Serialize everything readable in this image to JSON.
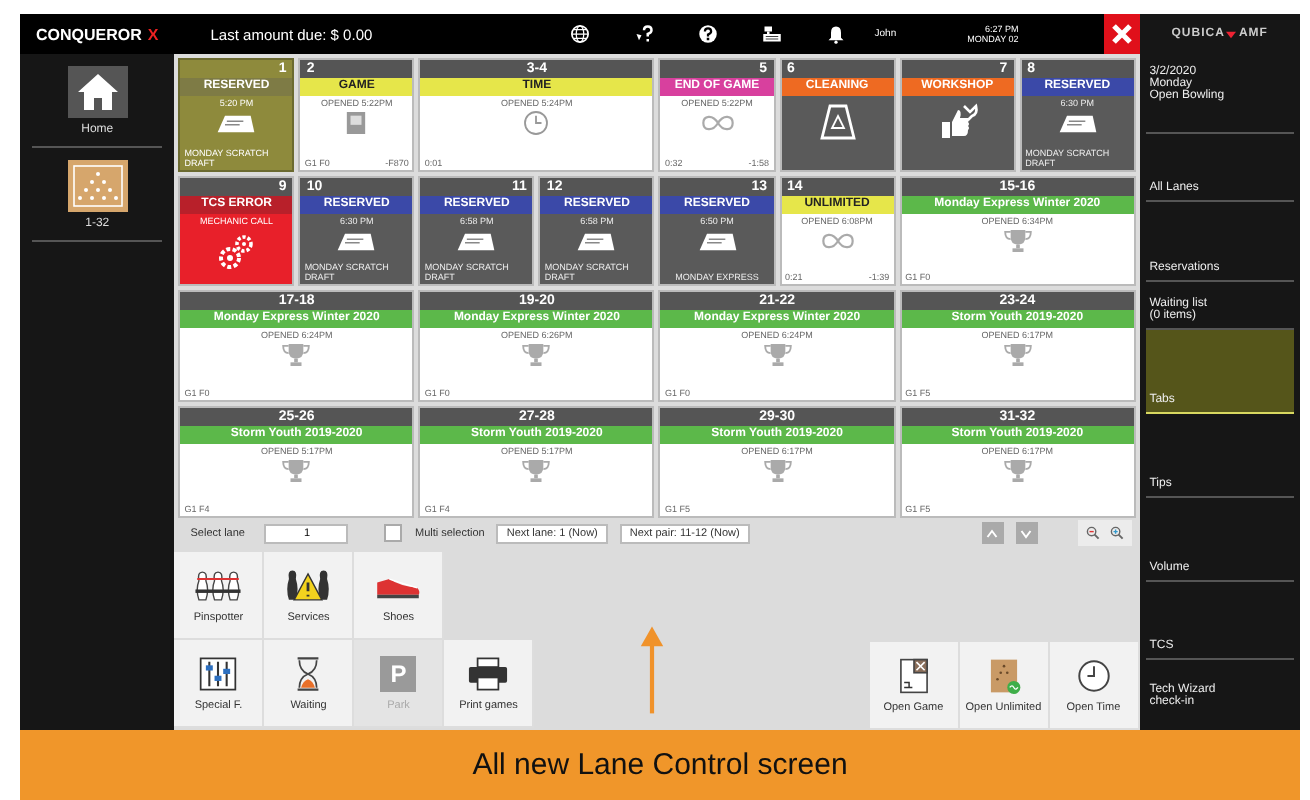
{
  "app_logo": {
    "name": "CONQUEROR",
    "mark": "X"
  },
  "top_bar": {
    "amount_due": "Last amount due: $ 0.00",
    "user": "John",
    "time": "6:27 PM",
    "date": "MONDAY 02"
  },
  "vendor_logo": {
    "left": "QUBICA",
    "right": "AMF"
  },
  "left_nav": [
    {
      "label": "Home"
    },
    {
      "label": "1-32"
    }
  ],
  "lanes": [
    {
      "number": "1",
      "kind": "reserved",
      "selected": true,
      "status": "RESERVED",
      "color": "#7e7b45",
      "info": "5:20 PM",
      "footer_left": "MONDAY SCRATCH DRAFT"
    },
    {
      "number": "2",
      "kind": "game",
      "selected": false,
      "status": "GAME",
      "color": "#e6e64a",
      "info": "OPENED 5:22PM",
      "footer_left": "G1 F0",
      "footer_right": "-F870"
    },
    {
      "number": "3-4",
      "kind": "time",
      "selected": false,
      "status": "TIME",
      "color": "#e6e64a",
      "info": "OPENED 5:24PM",
      "footer_left": "0:01"
    },
    {
      "number": "5",
      "kind": "end",
      "selected": false,
      "status": "END OF GAME",
      "color": "#d8409e",
      "info": "OPENED 5:22PM",
      "footer_left": "0:32",
      "footer_right": "-1:58"
    },
    {
      "number": "6",
      "kind": "cleaning",
      "selected": false,
      "status": "CLEANING",
      "color": "#ee6a22"
    },
    {
      "number": "7",
      "kind": "workshop",
      "selected": false,
      "status": "WORKSHOP",
      "color": "#ee6a22"
    },
    {
      "number": "8",
      "kind": "reserved",
      "selected": false,
      "status": "RESERVED",
      "color": "#3b49a8",
      "info": "6:30 PM",
      "footer_left": "MONDAY SCRATCH DRAFT"
    },
    {
      "number": "9",
      "kind": "error",
      "selected": false,
      "status": "TCS ERROR",
      "color": "#b8202a",
      "info": "MECHANIC CALL"
    },
    {
      "number": "10",
      "kind": "reserved",
      "selected": false,
      "status": "RESERVED",
      "color": "#3b49a8",
      "info": "6:30 PM",
      "footer_left": "MONDAY SCRATCH DRAFT"
    },
    {
      "number": "11",
      "kind": "reserved",
      "selected": false,
      "status": "RESERVED",
      "color": "#3b49a8",
      "info": "6:58 PM",
      "footer_left": "MONDAY SCRATCH DRAFT"
    },
    {
      "number": "12",
      "kind": "reserved",
      "selected": false,
      "status": "RESERVED",
      "color": "#3b49a8",
      "info": "6:58 PM",
      "footer_left": "MONDAY SCRATCH DRAFT"
    },
    {
      "number": "13",
      "kind": "reserved",
      "selected": false,
      "status": "RESERVED",
      "color": "#3b49a8",
      "info": "6:50 PM",
      "footer_left": "MONDAY EXPRESS"
    },
    {
      "number": "14",
      "kind": "unlimited",
      "selected": false,
      "status": "UNLIMITED",
      "color": "#e6e64a",
      "info": "OPENED 6:08PM",
      "footer_left": "0:21",
      "footer_right": "-1:39"
    },
    {
      "number": "15-16",
      "kind": "league",
      "selected": false,
      "status": "Monday Express Winter 2020",
      "color": "#5cb84a",
      "info": "OPENED 6:34PM",
      "footer_left": "G1 F0"
    },
    {
      "number": "17-18",
      "kind": "league",
      "selected": false,
      "status": "Monday Express Winter 2020",
      "color": "#5cb84a",
      "info": "OPENED 6:24PM",
      "footer_left": "G1 F0"
    },
    {
      "number": "19-20",
      "kind": "league",
      "selected": false,
      "status": "Monday Express Winter 2020",
      "color": "#5cb84a",
      "info": "OPENED 6:26PM",
      "footer_left": "G1 F0"
    },
    {
      "number": "21-22",
      "kind": "league",
      "selected": false,
      "status": "Monday Express Winter 2020",
      "color": "#5cb84a",
      "info": "OPENED 6:24PM",
      "footer_left": "G1 F0"
    },
    {
      "number": "23-24",
      "kind": "league",
      "selected": false,
      "status": "Storm Youth 2019-2020",
      "color": "#5cb84a",
      "info": "OPENED 6:17PM",
      "footer_left": "G1 F5"
    },
    {
      "number": "25-26",
      "kind": "league",
      "selected": false,
      "status": "Storm Youth 2019-2020",
      "color": "#5cb84a",
      "info": "OPENED 5:17PM",
      "footer_left": "G1 F4"
    },
    {
      "number": "27-28",
      "kind": "league",
      "selected": false,
      "status": "Storm Youth 2019-2020",
      "color": "#5cb84a",
      "info": "OPENED 5:17PM",
      "footer_left": "G1 F4"
    },
    {
      "number": "29-30",
      "kind": "league",
      "selected": false,
      "status": "Storm Youth 2019-2020",
      "color": "#5cb84a",
      "info": "OPENED 6:17PM",
      "footer_left": "G1 F5"
    },
    {
      "number": "31-32",
      "kind": "league",
      "selected": false,
      "status": "Storm Youth 2019-2020",
      "color": "#5cb84a",
      "info": "OPENED 6:17PM",
      "footer_left": "G1 F5"
    }
  ],
  "lane_toolbar": {
    "select_label": "Select lane",
    "select_value": "1",
    "multi_label": "Multi selection",
    "multi_checked": false,
    "next_lane": "Next lane: 1 (Now)",
    "next_pair": "Next pair: 11-12 (Now)"
  },
  "function_rows": [
    [
      {
        "label": "Pinspotter",
        "kind": "pins",
        "disabled": false
      },
      {
        "label": "Services",
        "kind": "warning",
        "disabled": false
      },
      {
        "label": "Shoes",
        "kind": "shoe",
        "disabled": false
      }
    ],
    [
      {
        "label": "Special F.",
        "kind": "sliders",
        "disabled": false
      },
      {
        "label": "Waiting",
        "kind": "hourglass",
        "disabled": false
      },
      {
        "label": "Park",
        "kind": "park",
        "badge": "P",
        "disabled": true
      },
      {
        "label": "Print games",
        "kind": "printer",
        "disabled": false
      }
    ]
  ],
  "open_buttons": [
    {
      "label": "Open Game",
      "kind": "game"
    },
    {
      "label": "Open Unlimited",
      "kind": "unlimited"
    },
    {
      "label": "Open Time",
      "kind": "clock"
    }
  ],
  "right_nav": [
    {
      "label": "3/2/2020\nMonday\nOpen Bowling",
      "selected": false
    },
    {
      "label": "All Lanes",
      "selected": false
    },
    {
      "label": "Reservations",
      "selected": false
    },
    {
      "label": "Waiting list\n(0 items)",
      "selected": false
    },
    {
      "label": "Tabs",
      "selected": true
    },
    {
      "label": "Tips",
      "selected": false
    },
    {
      "label": "Volume",
      "selected": false
    },
    {
      "label": "TCS",
      "selected": false
    },
    {
      "label": "Tech Wizard\ncheck-in",
      "selected": false
    }
  ],
  "banner": {
    "caption": "All new Lane Control screen"
  }
}
